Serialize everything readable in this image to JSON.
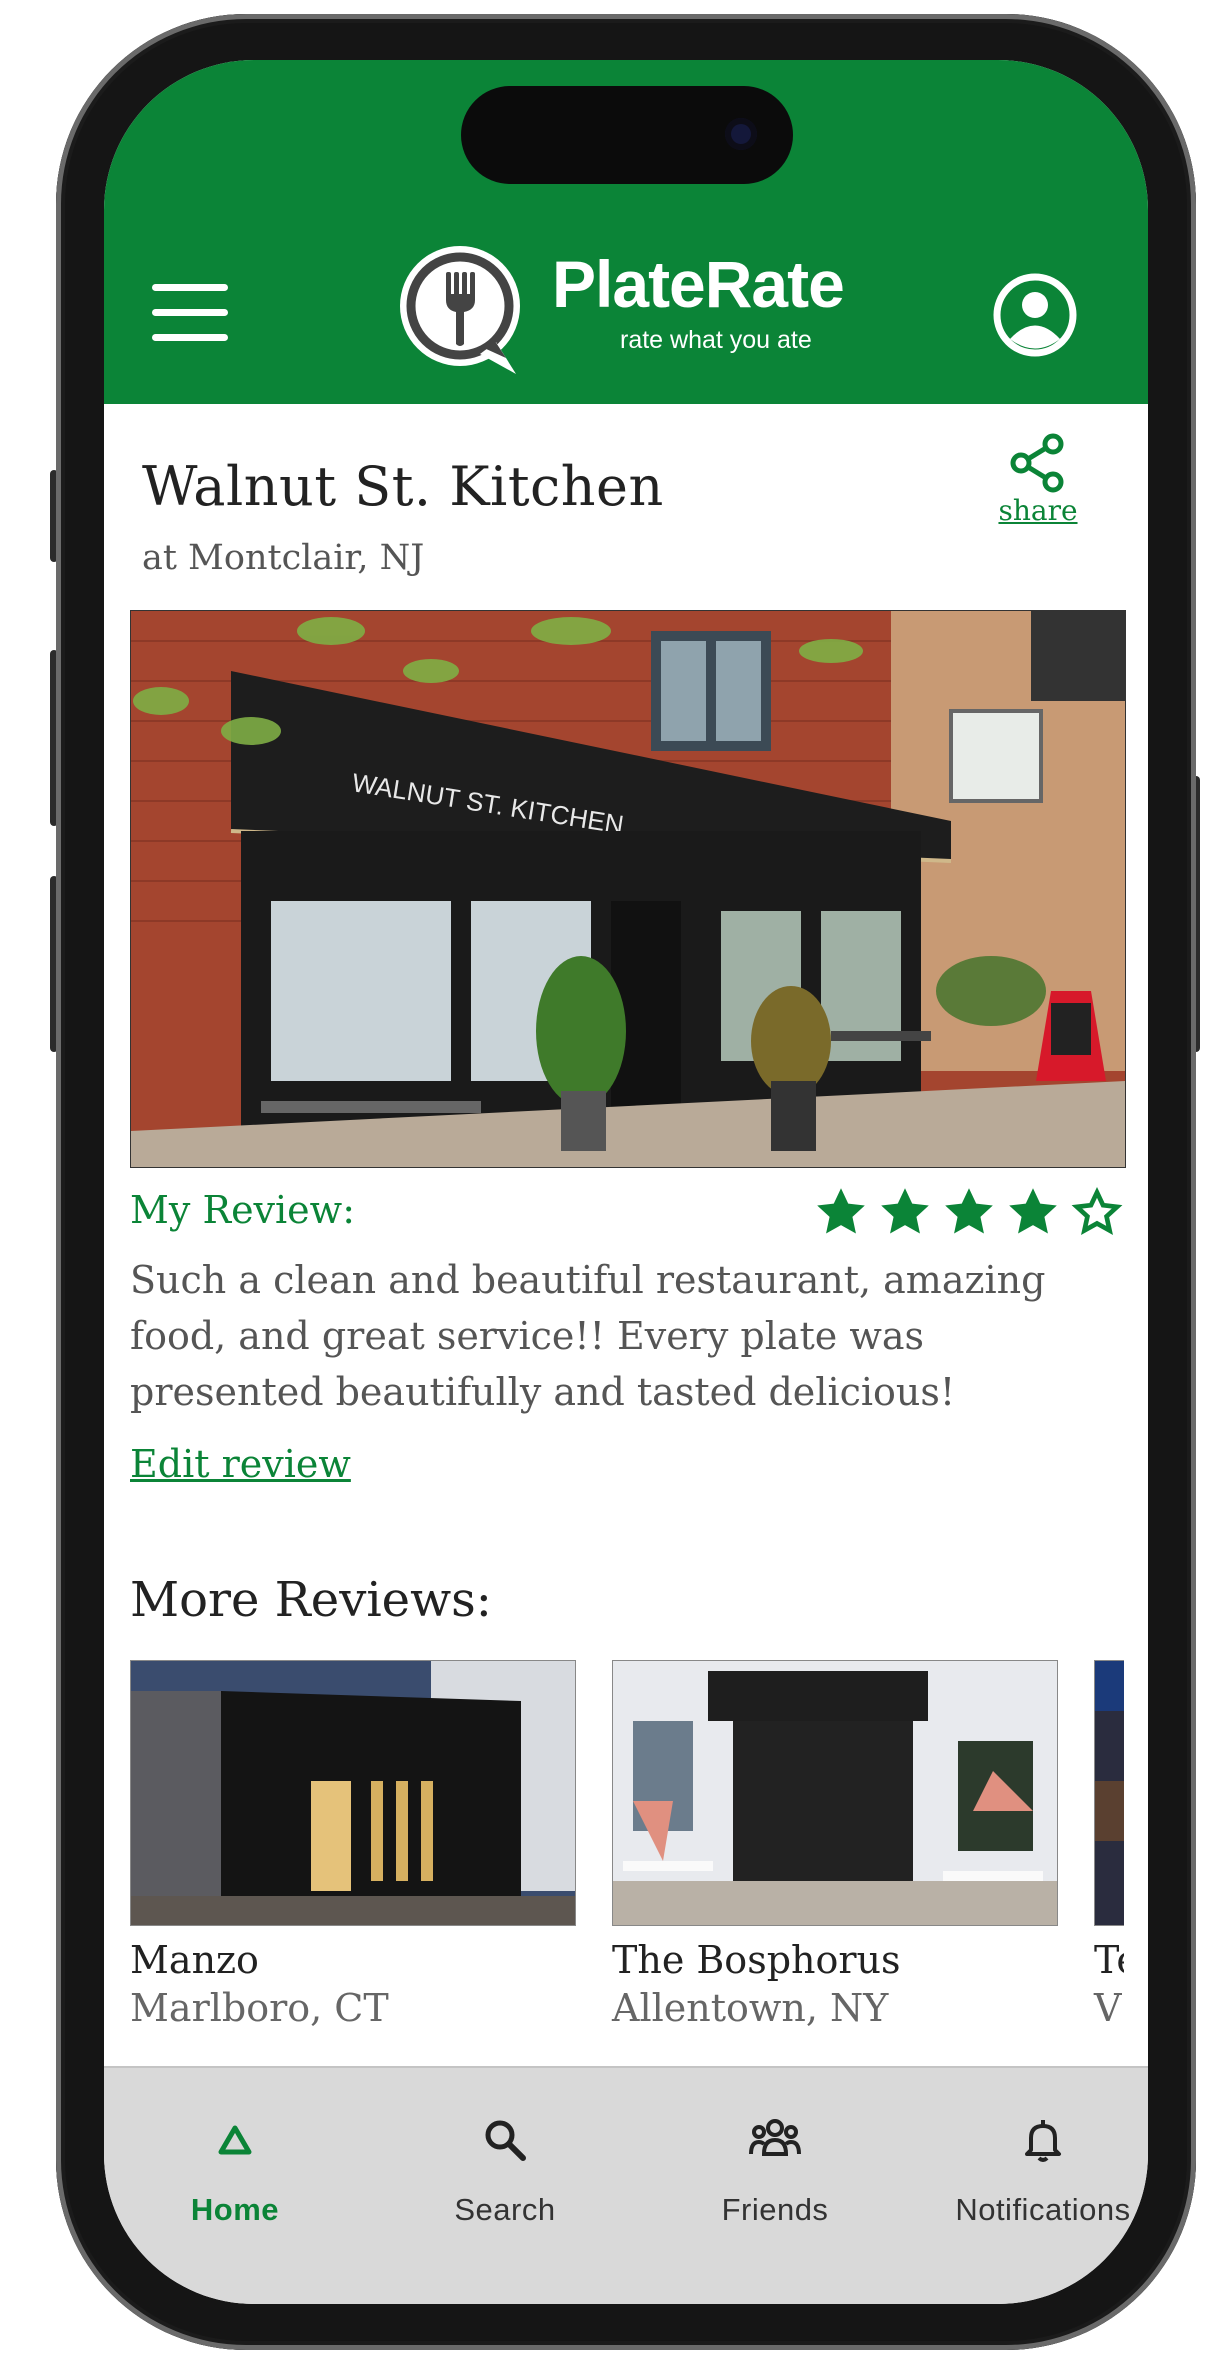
{
  "colors": {
    "brand_green": "#0b8437",
    "nav_background": "#d9d9d9",
    "text_dark": "#222222",
    "text_muted": "#555555"
  },
  "header": {
    "menu_icon": "hamburger-menu-icon",
    "logo": {
      "name": "PlateRate",
      "tagline": "rate what you ate",
      "icon": "fork-speech-bubble-icon"
    },
    "profile_icon": "user-circle-icon"
  },
  "restaurant": {
    "name": "Walnut St. Kitchen",
    "location": "at Montclair, NJ",
    "share_label": "share",
    "share_icon": "share-icon",
    "photo_sign_text": "WALNUT ST. KITCHEN"
  },
  "my_review": {
    "label": "My Review:",
    "rating": 4,
    "rating_max": 5,
    "text": "Such a clean and beautiful restaurant, amazing food, and great service!! Every plate was presented beautifully and tasted delicious!",
    "edit_label": "Edit review"
  },
  "more_reviews": {
    "title": "More Reviews:",
    "items": [
      {
        "name": "Manzo",
        "location": "Marlboro, CT"
      },
      {
        "name": "The Bosphorus",
        "location": "Allentown, NY"
      },
      {
        "name": "Te",
        "location": "V"
      }
    ]
  },
  "bottom_nav": {
    "items": [
      {
        "label": "Home",
        "icon": "home-triangle-icon",
        "active": true
      },
      {
        "label": "Search",
        "icon": "search-icon",
        "active": false
      },
      {
        "label": "Friends",
        "icon": "friends-icon",
        "active": false
      },
      {
        "label": "Notifications",
        "icon": "bell-icon",
        "active": false
      }
    ]
  }
}
